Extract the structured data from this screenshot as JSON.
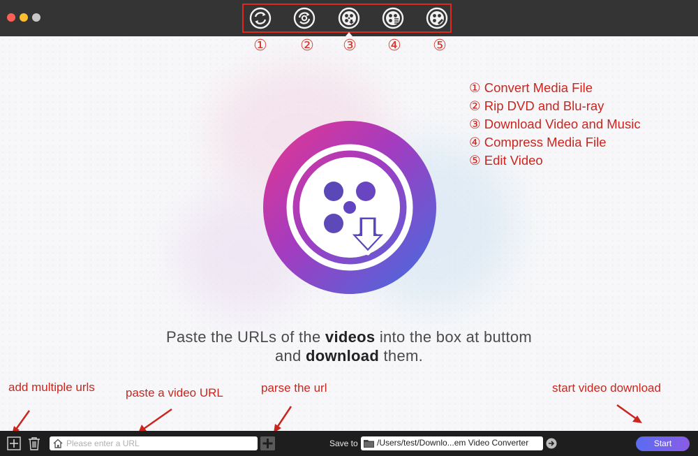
{
  "window": {
    "controls": [
      "close",
      "minimize",
      "zoom"
    ]
  },
  "toolbar": {
    "tools": [
      {
        "id": "convert",
        "icon": "convert-icon",
        "num": "①"
      },
      {
        "id": "rip",
        "icon": "disc-rip-icon",
        "num": "②"
      },
      {
        "id": "download",
        "icon": "download-video-icon",
        "num": "③"
      },
      {
        "id": "compress",
        "icon": "compress-icon",
        "num": "④"
      },
      {
        "id": "edit",
        "icon": "edit-video-icon",
        "num": "⑤"
      }
    ]
  },
  "legend": [
    "① Convert Media File",
    "② Rip DVD and Blu-ray",
    "③ Download Video and Music",
    "④ Compress Media File",
    "⑤ Edit Video"
  ],
  "headline": {
    "line1_a": "Paste the URLs of the ",
    "line1_b": "videos",
    "line1_c": " into the box at buttom",
    "line2_a": "and ",
    "line2_b": "download",
    "line2_c": " them."
  },
  "annotations": {
    "add": "add multiple urls",
    "paste": "paste a video URL",
    "parse": "parse the url",
    "start": "start video download"
  },
  "bottombar": {
    "url_placeholder": "Please enter a URL",
    "url_value": "",
    "save_to_label": "Save to",
    "save_path": "/Users/test/Downlo...em Video Converter",
    "start_label": "Start"
  },
  "colors": {
    "annotation_red": "#c8261e",
    "titlebar": "#343434",
    "bottombar": "#1e1e1e",
    "start_gradient": [
      "#5b6cf0",
      "#8a5ce6"
    ]
  }
}
